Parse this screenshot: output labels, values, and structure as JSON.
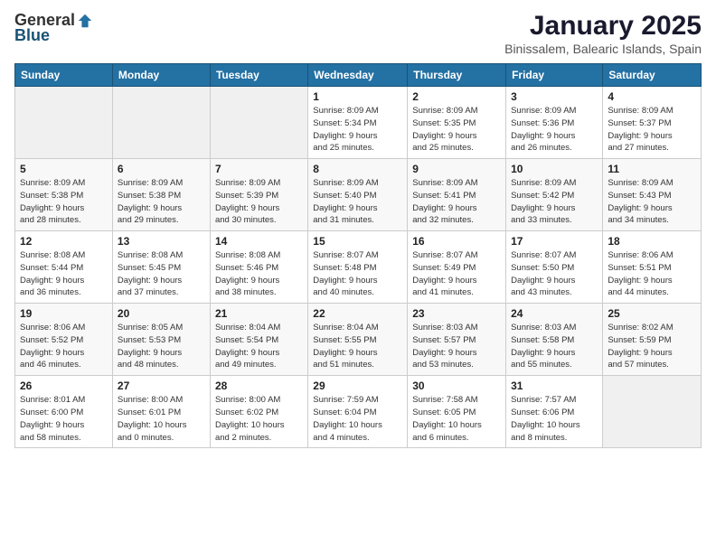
{
  "logo": {
    "general": "General",
    "blue": "Blue"
  },
  "title": "January 2025",
  "subtitle": "Binissalem, Balearic Islands, Spain",
  "days_header": [
    "Sunday",
    "Monday",
    "Tuesday",
    "Wednesday",
    "Thursday",
    "Friday",
    "Saturday"
  ],
  "weeks": [
    [
      {
        "num": "",
        "info": ""
      },
      {
        "num": "",
        "info": ""
      },
      {
        "num": "",
        "info": ""
      },
      {
        "num": "1",
        "info": "Sunrise: 8:09 AM\nSunset: 5:34 PM\nDaylight: 9 hours\nand 25 minutes."
      },
      {
        "num": "2",
        "info": "Sunrise: 8:09 AM\nSunset: 5:35 PM\nDaylight: 9 hours\nand 25 minutes."
      },
      {
        "num": "3",
        "info": "Sunrise: 8:09 AM\nSunset: 5:36 PM\nDaylight: 9 hours\nand 26 minutes."
      },
      {
        "num": "4",
        "info": "Sunrise: 8:09 AM\nSunset: 5:37 PM\nDaylight: 9 hours\nand 27 minutes."
      }
    ],
    [
      {
        "num": "5",
        "info": "Sunrise: 8:09 AM\nSunset: 5:38 PM\nDaylight: 9 hours\nand 28 minutes."
      },
      {
        "num": "6",
        "info": "Sunrise: 8:09 AM\nSunset: 5:38 PM\nDaylight: 9 hours\nand 29 minutes."
      },
      {
        "num": "7",
        "info": "Sunrise: 8:09 AM\nSunset: 5:39 PM\nDaylight: 9 hours\nand 30 minutes."
      },
      {
        "num": "8",
        "info": "Sunrise: 8:09 AM\nSunset: 5:40 PM\nDaylight: 9 hours\nand 31 minutes."
      },
      {
        "num": "9",
        "info": "Sunrise: 8:09 AM\nSunset: 5:41 PM\nDaylight: 9 hours\nand 32 minutes."
      },
      {
        "num": "10",
        "info": "Sunrise: 8:09 AM\nSunset: 5:42 PM\nDaylight: 9 hours\nand 33 minutes."
      },
      {
        "num": "11",
        "info": "Sunrise: 8:09 AM\nSunset: 5:43 PM\nDaylight: 9 hours\nand 34 minutes."
      }
    ],
    [
      {
        "num": "12",
        "info": "Sunrise: 8:08 AM\nSunset: 5:44 PM\nDaylight: 9 hours\nand 36 minutes."
      },
      {
        "num": "13",
        "info": "Sunrise: 8:08 AM\nSunset: 5:45 PM\nDaylight: 9 hours\nand 37 minutes."
      },
      {
        "num": "14",
        "info": "Sunrise: 8:08 AM\nSunset: 5:46 PM\nDaylight: 9 hours\nand 38 minutes."
      },
      {
        "num": "15",
        "info": "Sunrise: 8:07 AM\nSunset: 5:48 PM\nDaylight: 9 hours\nand 40 minutes."
      },
      {
        "num": "16",
        "info": "Sunrise: 8:07 AM\nSunset: 5:49 PM\nDaylight: 9 hours\nand 41 minutes."
      },
      {
        "num": "17",
        "info": "Sunrise: 8:07 AM\nSunset: 5:50 PM\nDaylight: 9 hours\nand 43 minutes."
      },
      {
        "num": "18",
        "info": "Sunrise: 8:06 AM\nSunset: 5:51 PM\nDaylight: 9 hours\nand 44 minutes."
      }
    ],
    [
      {
        "num": "19",
        "info": "Sunrise: 8:06 AM\nSunset: 5:52 PM\nDaylight: 9 hours\nand 46 minutes."
      },
      {
        "num": "20",
        "info": "Sunrise: 8:05 AM\nSunset: 5:53 PM\nDaylight: 9 hours\nand 48 minutes."
      },
      {
        "num": "21",
        "info": "Sunrise: 8:04 AM\nSunset: 5:54 PM\nDaylight: 9 hours\nand 49 minutes."
      },
      {
        "num": "22",
        "info": "Sunrise: 8:04 AM\nSunset: 5:55 PM\nDaylight: 9 hours\nand 51 minutes."
      },
      {
        "num": "23",
        "info": "Sunrise: 8:03 AM\nSunset: 5:57 PM\nDaylight: 9 hours\nand 53 minutes."
      },
      {
        "num": "24",
        "info": "Sunrise: 8:03 AM\nSunset: 5:58 PM\nDaylight: 9 hours\nand 55 minutes."
      },
      {
        "num": "25",
        "info": "Sunrise: 8:02 AM\nSunset: 5:59 PM\nDaylight: 9 hours\nand 57 minutes."
      }
    ],
    [
      {
        "num": "26",
        "info": "Sunrise: 8:01 AM\nSunset: 6:00 PM\nDaylight: 9 hours\nand 58 minutes."
      },
      {
        "num": "27",
        "info": "Sunrise: 8:00 AM\nSunset: 6:01 PM\nDaylight: 10 hours\nand 0 minutes."
      },
      {
        "num": "28",
        "info": "Sunrise: 8:00 AM\nSunset: 6:02 PM\nDaylight: 10 hours\nand 2 minutes."
      },
      {
        "num": "29",
        "info": "Sunrise: 7:59 AM\nSunset: 6:04 PM\nDaylight: 10 hours\nand 4 minutes."
      },
      {
        "num": "30",
        "info": "Sunrise: 7:58 AM\nSunset: 6:05 PM\nDaylight: 10 hours\nand 6 minutes."
      },
      {
        "num": "31",
        "info": "Sunrise: 7:57 AM\nSunset: 6:06 PM\nDaylight: 10 hours\nand 8 minutes."
      },
      {
        "num": "",
        "info": ""
      }
    ]
  ]
}
